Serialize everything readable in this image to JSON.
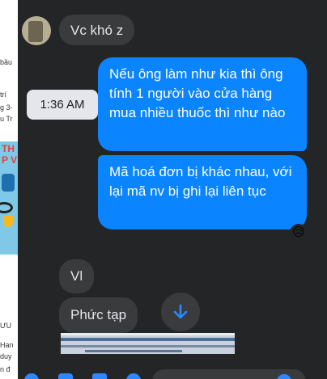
{
  "background_page": {
    "fragments": [
      "bầu",
      "trí",
      "g 3-",
      "u Tr",
      "ƯU",
      "Han",
      "duy",
      "n đ"
    ],
    "thumbnail_text": [
      "TH",
      "P V"
    ]
  },
  "chat": {
    "messages": [
      {
        "direction": "incoming",
        "text": "Vc khó z"
      },
      {
        "direction": "outgoing",
        "text": "Nếu ông làm như kia thì ông tính 1 người vào cửa hàng mua nhiều thuốc thì như nào"
      },
      {
        "direction": "outgoing",
        "text": "Mã hoá đơn bị khác nhau, với lại mã nv bị ghi lại liên tục",
        "reaction": "😥"
      },
      {
        "direction": "incoming",
        "text": "Vl"
      },
      {
        "direction": "incoming",
        "text": "Phức tạp"
      }
    ],
    "timestamp_tooltip": "1:36 AM"
  },
  "icons": {
    "avatar": "avatar-image",
    "scroll_down": "arrow-down-icon",
    "composer": [
      "plus-circle-icon",
      "image-icon",
      "sticker-icon",
      "gif-icon",
      "emoji-icon"
    ]
  },
  "colors": {
    "panel_bg": "#242526",
    "incoming_bubble": "#3a3b3c",
    "outgoing_bubble": "#0a84ff",
    "tooltip_bg": "#e4e6eb"
  }
}
